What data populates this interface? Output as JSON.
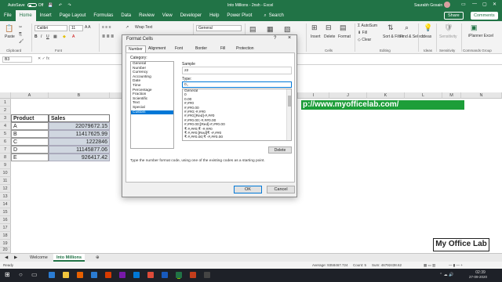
{
  "titlebar": {
    "autosave": "AutoSave",
    "autosave_state": "Off",
    "document": "Into Millions - 2nsh - Excel",
    "user": "Saurabh Gosain"
  },
  "tabs": [
    "File",
    "Home",
    "Insert",
    "Page Layout",
    "Formulas",
    "Data",
    "Review",
    "View",
    "Developer",
    "Help",
    "Power Pivot"
  ],
  "search": "Search",
  "share": "Share",
  "comments": "Comments",
  "ribbon": {
    "paste": "Paste",
    "font_name": "Calibri",
    "font_size": "11",
    "wrap_text": "Wrap Text",
    "number_format": "General",
    "insert": "Insert",
    "delete": "Delete",
    "format": "Format",
    "autosum": "AutoSum",
    "fill": "Fill",
    "clear": "Clear",
    "sort_filter": "Sort & Filter",
    "find_select": "Find & Select",
    "ideas": "Ideas",
    "sensitivity": "Sensitivity",
    "iplanner": "iPlanner Excel",
    "groups": [
      "Clipboard",
      "Font",
      "Alignment",
      "Number",
      "Cells",
      "Editing",
      "Ideas",
      "Sensitivity",
      "Commands Group"
    ]
  },
  "namebox": "B3",
  "columns": [
    "A",
    "B",
    "C",
    "D",
    "E",
    "F",
    "G",
    "H",
    "I",
    "J",
    "K",
    "L",
    "M",
    "N"
  ],
  "rows": [
    "1",
    "2",
    "3",
    "4",
    "5",
    "6",
    "7",
    "8",
    "9",
    "10",
    "11",
    "12",
    "13",
    "14",
    "15",
    "16",
    "17",
    "18",
    "19",
    "20"
  ],
  "table": {
    "headers": [
      "Product",
      "Sales"
    ],
    "rows": [
      [
        "A",
        "22079672.15"
      ],
      [
        "B",
        "11417625.99"
      ],
      [
        "C",
        "1222846"
      ],
      [
        "D",
        "11145877.06"
      ],
      [
        "E",
        "926417.42"
      ]
    ]
  },
  "url_text": "p://www.myofficelab.com/",
  "brand": "My Office Lab",
  "sheets": [
    "Welcome",
    "Into Millions"
  ],
  "status": {
    "ready": "Ready",
    "average": "Average: 9358467.724",
    "count": "Count: 5",
    "sum": "Sum: 46792438.62"
  },
  "taskbar": {
    "time": "02:39",
    "date": "27-09-2020"
  },
  "dialog": {
    "title": "Format Cells",
    "tabs": [
      "Number",
      "Alignment",
      "Font",
      "Border",
      "Fill",
      "Protection"
    ],
    "category_label": "Category:",
    "categories": [
      "General",
      "Number",
      "Currency",
      "Accounting",
      "Date",
      "Time",
      "Percentage",
      "Fraction",
      "Scientific",
      "Text",
      "Special",
      "Custom"
    ],
    "selected_category": "Custom",
    "sample_label": "Sample",
    "sample_value": "22",
    "type_label": "Type:",
    "type_value": "0,,",
    "formats": [
      "General",
      "0",
      "0.00",
      "#,##0",
      "#,##0.00",
      "#,##0;-#,##0",
      "#,##0;[Red]-#,##0",
      "#,##0.00;-#,##0.00",
      "#,##0.00;[Red]-#,##0.00",
      "₹ #,##0;₹ -#,##0",
      "₹ #,##0;[Red]₹ -#,##0",
      "₹ #,##0.00;₹ -#,##0.00"
    ],
    "delete": "Delete",
    "help": "Type the number format code, using one of the existing codes as a starting point.",
    "ok": "OK",
    "cancel": "Cancel"
  }
}
